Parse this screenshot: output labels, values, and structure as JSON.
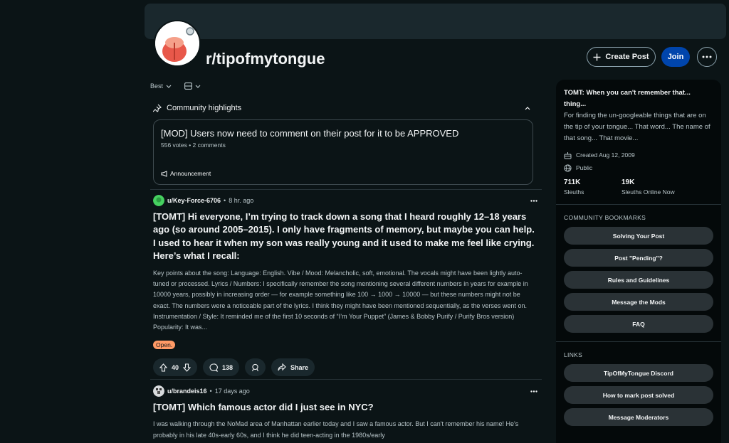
{
  "subreddit": {
    "name": "r/tipofmytongue"
  },
  "header": {
    "create_post_label": "Create Post",
    "join_label": "Join"
  },
  "sort": {
    "selected": "Best"
  },
  "highlights": {
    "label": "Community highlights",
    "card": {
      "title": "[MOD] Users now need to comment on their post for it to be APPROVED",
      "meta": "556 votes • 2 comments",
      "tag": "Announcement"
    }
  },
  "posts": [
    {
      "author": "u/Key-Force-6706",
      "time": "8 hr. ago",
      "title": "[TOMT] Hi everyone, I’m trying to track down a song that I heard roughly 12–18 years ago (so around 2005–2015). I only have fragments of memory, but maybe you can help. I used to hear it when my son was really young and it used to make me feel like crying. Here’s what I recall:",
      "body": "Key points about the song: Language: English. Vibe / Mood: Melancholic, soft, emotional. The vocals might have been lightly auto-tuned or processed. Lyrics / Numbers: I specifically remember the song mentioning several different numbers in years for example in 10000 years, possibly in increasing order — for example something like 100 → 1000 → 10000 — but these numbers might not be exact. The numbers were a noticeable part of the lyrics. I think they might have been mentioned sequentially, as the verses went on. Instrumentation / Style: It reminded me of the first 10 seconds of “I’m Your Puppet” (James & Bobby Purify / Purify Bros version) Popularity: It was...",
      "flair": "Open.",
      "votes": "40",
      "comments": "138",
      "share_label": "Share"
    },
    {
      "author": "u/brandeis16",
      "time": "17 days ago",
      "title": "[TOMT] Which famous actor did I just see in NYC?",
      "body": "I was walking through the NoMad area of Manhattan earlier today and I saw a famous actor. But I can't remember his name! He's probably in his late 40s-early 60s, and I think he did teen-acting in the 1980s/early"
    }
  ],
  "sidebar": {
    "title": "TOMT: When you can't remember that... thing...",
    "description": "For finding the un-googleable things that are on the tip of your tongue... That word... The name of that song... That movie...",
    "created": "Created Aug 12, 2009",
    "visibility": "Public",
    "members_value": "711K",
    "members_label": "Sleuths",
    "online_value": "19K",
    "online_label": "Sleuths Online Now",
    "bookmarks_heading": "COMMUNITY BOOKMARKS",
    "bookmarks": [
      "Solving Your Post",
      "Post \"Pending\"?",
      "Rules and Guidelines",
      "Message the Mods",
      "FAQ"
    ],
    "links_heading": "LINKS",
    "links": [
      "TipOfMyTongue Discord",
      "How to mark post solved",
      "Message Moderators"
    ]
  },
  "colors": {
    "background": "#0b1416",
    "join_button": "#0045ac",
    "flair_open": "#ff9a66",
    "pill": "#2a3236"
  }
}
